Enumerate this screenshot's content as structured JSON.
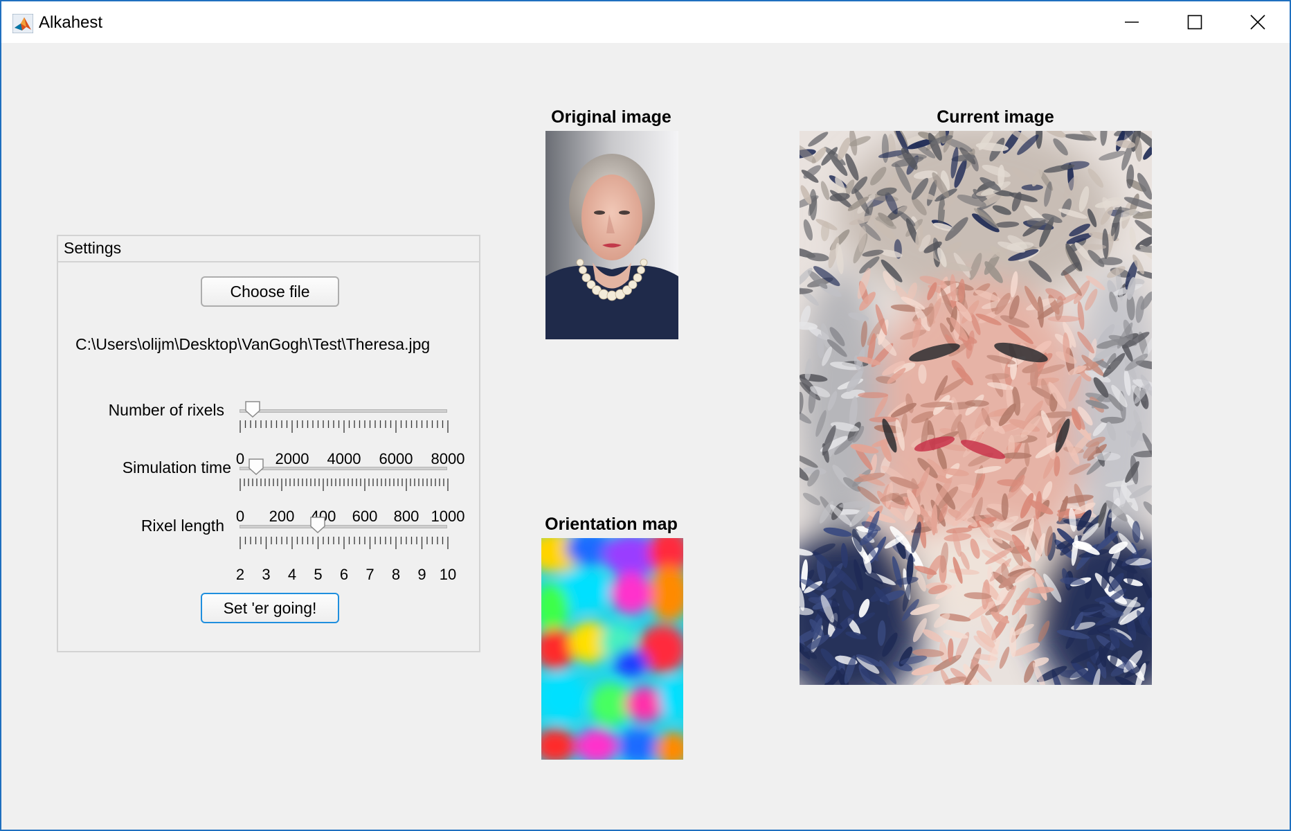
{
  "window": {
    "title": "Alkahest",
    "icon": "matlab-icon",
    "controls": [
      "minimize-icon",
      "maximize-icon",
      "close-icon"
    ]
  },
  "settings": {
    "title": "Settings",
    "choose_file_label": "Choose file",
    "file_path": "C:\\Users\\olijm\\Desktop\\VanGogh\\Test\\Theresa.jpg",
    "sliders": [
      {
        "label": "Number of rixels",
        "min": 0,
        "max": 8000,
        "value": 500,
        "tick_labels": [
          "0",
          "2000",
          "4000",
          "6000",
          "8000"
        ]
      },
      {
        "label": "Simulation time",
        "min": 0,
        "max": 1000,
        "value": 80,
        "tick_labels": [
          "0",
          "200",
          "400",
          "600",
          "800",
          "1000"
        ]
      },
      {
        "label": "Rixel length",
        "min": 2,
        "max": 10,
        "value": 5,
        "tick_labels": [
          "2",
          "3",
          "4",
          "5",
          "6",
          "7",
          "8",
          "9",
          "10"
        ]
      }
    ],
    "start_label": "Set 'er going!"
  },
  "axes": {
    "original_title": "Original image",
    "orientation_title": "Orientation map",
    "current_title": "Current image"
  },
  "colors": {
    "window_border": "#1f6fbf",
    "window_bg": "#f0f0f0",
    "focus_button_border": "#1f8fde"
  }
}
